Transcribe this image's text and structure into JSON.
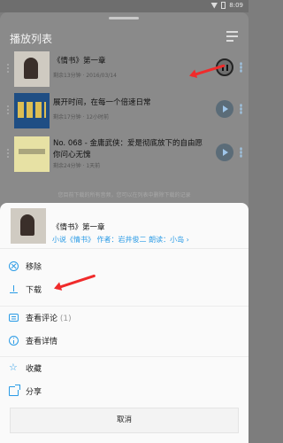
{
  "playlist": {
    "title": "播放列表",
    "hint": "您目前下载的所有音频，您可以在列表中删除下载的记录",
    "episodes": [
      {
        "title": "《情书》第一章",
        "meta": "剩余13分钟 · 2016/03/14",
        "state": "playing"
      },
      {
        "title": "展开时间，在每一个倍速日常",
        "meta": "剩余17分钟 · 12小时前",
        "state": "paused"
      },
      {
        "title": "No. 068 - 金庸武侠：爱是彻底放下的自由愿你问心无愧",
        "meta": "剩余24分钟 · 1天前",
        "state": "paused"
      }
    ]
  },
  "current": {
    "title": "《情书》第一章",
    "subtitle": "小说《情书》 作者：岩井俊二 朗读：小岛 ›"
  },
  "menu": {
    "remove": "移除",
    "download": "下载",
    "comments": "查看评论",
    "comment_count": "(1)",
    "details": "查看详情",
    "favorite": "收藏",
    "share": "分享",
    "cancel": "取消"
  },
  "statusbar": {
    "time": "8:09"
  },
  "colors": {
    "accent": "#2a9be6",
    "annotation": "#f02b2b"
  }
}
